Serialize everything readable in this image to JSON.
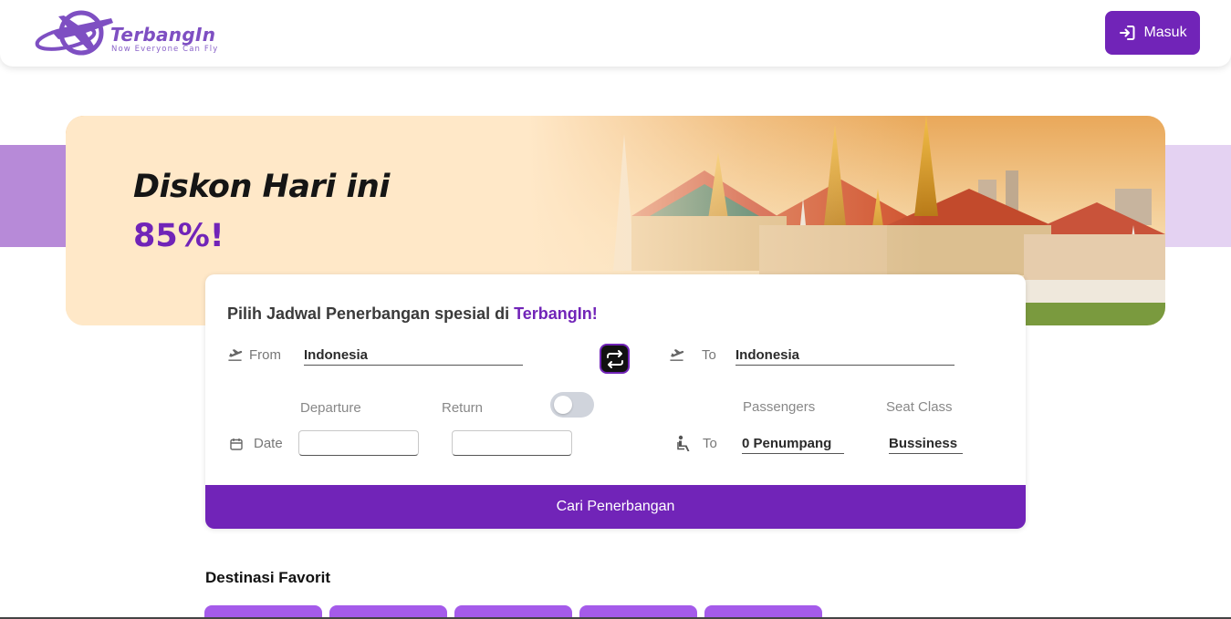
{
  "header": {
    "logo_name": "TerbangIn",
    "logo_tagline": "Now Everyone Can Fly",
    "login_label": "Masuk",
    "login_icon": "login-icon"
  },
  "hero": {
    "title": "Diskon Hari ini",
    "discount": "85%!",
    "image": "temple-skyline"
  },
  "search": {
    "title_prefix": "Pilih Jadwal Penerbangan spesial di ",
    "title_brand": "TerbangIn!",
    "from_label": "From",
    "from_value": "Indonesia",
    "to_label": "To",
    "to_value": "Indonesia",
    "swap_icon": "swap-icon",
    "departure_label": "Departure",
    "return_label": "Return",
    "return_toggle_on": false,
    "date_label": "Date",
    "departure_value": "",
    "return_value": "",
    "passengers_label": "Passengers",
    "seat_class_label": "Seat Class",
    "passenger_to_label": "To",
    "passengers_value": "0 Penumpang",
    "seat_class_value": "Bussiness",
    "search_button": "Cari Penerbangan"
  },
  "favorites": {
    "title": "Destinasi Favorit",
    "chips": [
      "",
      "",
      "",
      "",
      ""
    ]
  },
  "colors": {
    "primary": "#7124b8",
    "chip": "#a55bea",
    "hero_bg": "#ffe8c8",
    "band_left": "#b78ad8",
    "band_right": "#e4d2f2"
  }
}
